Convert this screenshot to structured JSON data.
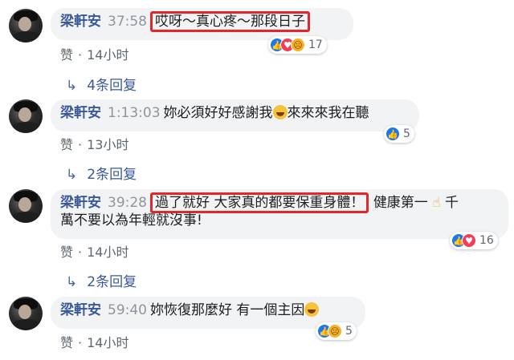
{
  "comments": [
    {
      "name": "梁軒安",
      "time": "37:58",
      "text": "哎呀～真心疼～那段日子",
      "like": "赞",
      "ago": "14小时",
      "reaction_count": "17",
      "reactions": [
        "like-icon",
        "love-icon",
        "sad-icon"
      ],
      "replies": "4条回复"
    },
    {
      "name": "梁軒安",
      "time": "1:13:03",
      "text": "妳必須好好感謝我",
      "text_tail": "來來來我在聽",
      "like": "赞",
      "ago": "13小时",
      "reaction_count": "5",
      "reactions": [
        "like-icon"
      ],
      "replies": "2条回复"
    },
    {
      "name": "梁軒安",
      "time": "39:28",
      "text_highlight": "過了就好 大家真的都要保重身體！",
      "text_rest": "健康第一",
      "text_rest2": "千",
      "text_line2": "萬不要以為年輕就沒事!",
      "like": "赞",
      "ago": "14小时",
      "reaction_count": "16",
      "reactions": [
        "like-icon",
        "love-icon"
      ],
      "replies": "2条回复"
    },
    {
      "name": "梁軒安",
      "time": "59:40",
      "text": "妳恢復那麼好 有一個主因",
      "like": "赞",
      "ago": "14小时",
      "reaction_count": "5",
      "reactions": [
        "like-icon",
        "sad-icon"
      ]
    }
  ],
  "colors": {
    "name": "#385898",
    "highlight_box": "#e4262b",
    "bubble": "#f2f3f5"
  }
}
